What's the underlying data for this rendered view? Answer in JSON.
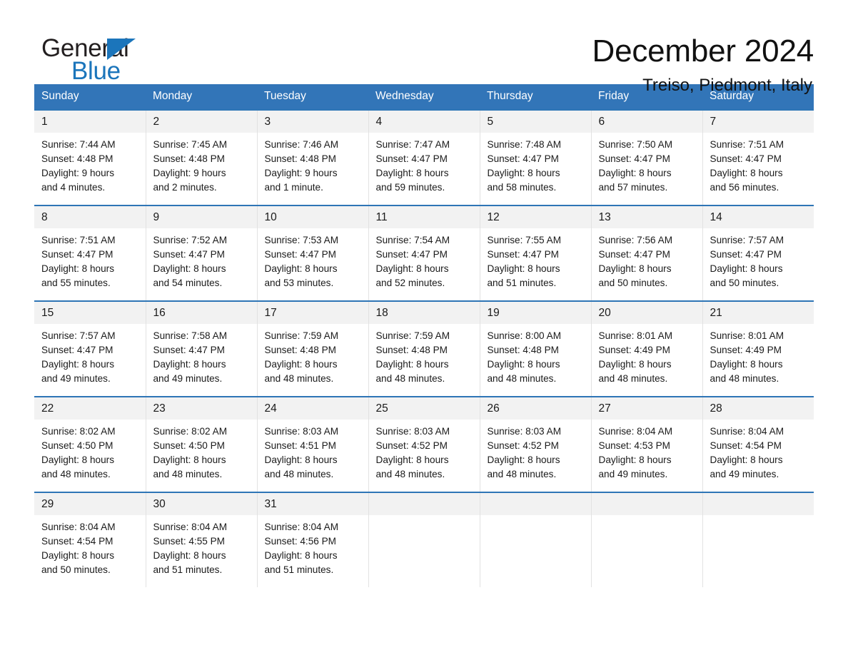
{
  "brand": {
    "name_top": "General",
    "name_bottom": "Blue",
    "accent_color": "#1b75bb"
  },
  "header": {
    "month_title": "December 2024",
    "location": "Treiso, Piedmont, Italy"
  },
  "calendar": {
    "header_bg": "#3275b8",
    "row_divider_color": "#2e75b6",
    "daynum_bg": "#f2f2f2",
    "weekday_headers": [
      "Sunday",
      "Monday",
      "Tuesday",
      "Wednesday",
      "Thursday",
      "Friday",
      "Saturday"
    ],
    "weeks": [
      [
        {
          "day": "1",
          "sunrise": "Sunrise: 7:44 AM",
          "sunset": "Sunset: 4:48 PM",
          "daylight_line1": "Daylight: 9 hours",
          "daylight_line2": "and 4 minutes."
        },
        {
          "day": "2",
          "sunrise": "Sunrise: 7:45 AM",
          "sunset": "Sunset: 4:48 PM",
          "daylight_line1": "Daylight: 9 hours",
          "daylight_line2": "and 2 minutes."
        },
        {
          "day": "3",
          "sunrise": "Sunrise: 7:46 AM",
          "sunset": "Sunset: 4:48 PM",
          "daylight_line1": "Daylight: 9 hours",
          "daylight_line2": "and 1 minute."
        },
        {
          "day": "4",
          "sunrise": "Sunrise: 7:47 AM",
          "sunset": "Sunset: 4:47 PM",
          "daylight_line1": "Daylight: 8 hours",
          "daylight_line2": "and 59 minutes."
        },
        {
          "day": "5",
          "sunrise": "Sunrise: 7:48 AM",
          "sunset": "Sunset: 4:47 PM",
          "daylight_line1": "Daylight: 8 hours",
          "daylight_line2": "and 58 minutes."
        },
        {
          "day": "6",
          "sunrise": "Sunrise: 7:50 AM",
          "sunset": "Sunset: 4:47 PM",
          "daylight_line1": "Daylight: 8 hours",
          "daylight_line2": "and 57 minutes."
        },
        {
          "day": "7",
          "sunrise": "Sunrise: 7:51 AM",
          "sunset": "Sunset: 4:47 PM",
          "daylight_line1": "Daylight: 8 hours",
          "daylight_line2": "and 56 minutes."
        }
      ],
      [
        {
          "day": "8",
          "sunrise": "Sunrise: 7:51 AM",
          "sunset": "Sunset: 4:47 PM",
          "daylight_line1": "Daylight: 8 hours",
          "daylight_line2": "and 55 minutes."
        },
        {
          "day": "9",
          "sunrise": "Sunrise: 7:52 AM",
          "sunset": "Sunset: 4:47 PM",
          "daylight_line1": "Daylight: 8 hours",
          "daylight_line2": "and 54 minutes."
        },
        {
          "day": "10",
          "sunrise": "Sunrise: 7:53 AM",
          "sunset": "Sunset: 4:47 PM",
          "daylight_line1": "Daylight: 8 hours",
          "daylight_line2": "and 53 minutes."
        },
        {
          "day": "11",
          "sunrise": "Sunrise: 7:54 AM",
          "sunset": "Sunset: 4:47 PM",
          "daylight_line1": "Daylight: 8 hours",
          "daylight_line2": "and 52 minutes."
        },
        {
          "day": "12",
          "sunrise": "Sunrise: 7:55 AM",
          "sunset": "Sunset: 4:47 PM",
          "daylight_line1": "Daylight: 8 hours",
          "daylight_line2": "and 51 minutes."
        },
        {
          "day": "13",
          "sunrise": "Sunrise: 7:56 AM",
          "sunset": "Sunset: 4:47 PM",
          "daylight_line1": "Daylight: 8 hours",
          "daylight_line2": "and 50 minutes."
        },
        {
          "day": "14",
          "sunrise": "Sunrise: 7:57 AM",
          "sunset": "Sunset: 4:47 PM",
          "daylight_line1": "Daylight: 8 hours",
          "daylight_line2": "and 50 minutes."
        }
      ],
      [
        {
          "day": "15",
          "sunrise": "Sunrise: 7:57 AM",
          "sunset": "Sunset: 4:47 PM",
          "daylight_line1": "Daylight: 8 hours",
          "daylight_line2": "and 49 minutes."
        },
        {
          "day": "16",
          "sunrise": "Sunrise: 7:58 AM",
          "sunset": "Sunset: 4:47 PM",
          "daylight_line1": "Daylight: 8 hours",
          "daylight_line2": "and 49 minutes."
        },
        {
          "day": "17",
          "sunrise": "Sunrise: 7:59 AM",
          "sunset": "Sunset: 4:48 PM",
          "daylight_line1": "Daylight: 8 hours",
          "daylight_line2": "and 48 minutes."
        },
        {
          "day": "18",
          "sunrise": "Sunrise: 7:59 AM",
          "sunset": "Sunset: 4:48 PM",
          "daylight_line1": "Daylight: 8 hours",
          "daylight_line2": "and 48 minutes."
        },
        {
          "day": "19",
          "sunrise": "Sunrise: 8:00 AM",
          "sunset": "Sunset: 4:48 PM",
          "daylight_line1": "Daylight: 8 hours",
          "daylight_line2": "and 48 minutes."
        },
        {
          "day": "20",
          "sunrise": "Sunrise: 8:01 AM",
          "sunset": "Sunset: 4:49 PM",
          "daylight_line1": "Daylight: 8 hours",
          "daylight_line2": "and 48 minutes."
        },
        {
          "day": "21",
          "sunrise": "Sunrise: 8:01 AM",
          "sunset": "Sunset: 4:49 PM",
          "daylight_line1": "Daylight: 8 hours",
          "daylight_line2": "and 48 minutes."
        }
      ],
      [
        {
          "day": "22",
          "sunrise": "Sunrise: 8:02 AM",
          "sunset": "Sunset: 4:50 PM",
          "daylight_line1": "Daylight: 8 hours",
          "daylight_line2": "and 48 minutes."
        },
        {
          "day": "23",
          "sunrise": "Sunrise: 8:02 AM",
          "sunset": "Sunset: 4:50 PM",
          "daylight_line1": "Daylight: 8 hours",
          "daylight_line2": "and 48 minutes."
        },
        {
          "day": "24",
          "sunrise": "Sunrise: 8:03 AM",
          "sunset": "Sunset: 4:51 PM",
          "daylight_line1": "Daylight: 8 hours",
          "daylight_line2": "and 48 minutes."
        },
        {
          "day": "25",
          "sunrise": "Sunrise: 8:03 AM",
          "sunset": "Sunset: 4:52 PM",
          "daylight_line1": "Daylight: 8 hours",
          "daylight_line2": "and 48 minutes."
        },
        {
          "day": "26",
          "sunrise": "Sunrise: 8:03 AM",
          "sunset": "Sunset: 4:52 PM",
          "daylight_line1": "Daylight: 8 hours",
          "daylight_line2": "and 48 minutes."
        },
        {
          "day": "27",
          "sunrise": "Sunrise: 8:04 AM",
          "sunset": "Sunset: 4:53 PM",
          "daylight_line1": "Daylight: 8 hours",
          "daylight_line2": "and 49 minutes."
        },
        {
          "day": "28",
          "sunrise": "Sunrise: 8:04 AM",
          "sunset": "Sunset: 4:54 PM",
          "daylight_line1": "Daylight: 8 hours",
          "daylight_line2": "and 49 minutes."
        }
      ],
      [
        {
          "day": "29",
          "sunrise": "Sunrise: 8:04 AM",
          "sunset": "Sunset: 4:54 PM",
          "daylight_line1": "Daylight: 8 hours",
          "daylight_line2": "and 50 minutes."
        },
        {
          "day": "30",
          "sunrise": "Sunrise: 8:04 AM",
          "sunset": "Sunset: 4:55 PM",
          "daylight_line1": "Daylight: 8 hours",
          "daylight_line2": "and 51 minutes."
        },
        {
          "day": "31",
          "sunrise": "Sunrise: 8:04 AM",
          "sunset": "Sunset: 4:56 PM",
          "daylight_line1": "Daylight: 8 hours",
          "daylight_line2": "and 51 minutes."
        },
        {
          "day": "",
          "sunrise": "",
          "sunset": "",
          "daylight_line1": "",
          "daylight_line2": ""
        },
        {
          "day": "",
          "sunrise": "",
          "sunset": "",
          "daylight_line1": "",
          "daylight_line2": ""
        },
        {
          "day": "",
          "sunrise": "",
          "sunset": "",
          "daylight_line1": "",
          "daylight_line2": ""
        },
        {
          "day": "",
          "sunrise": "",
          "sunset": "",
          "daylight_line1": "",
          "daylight_line2": ""
        }
      ]
    ]
  }
}
